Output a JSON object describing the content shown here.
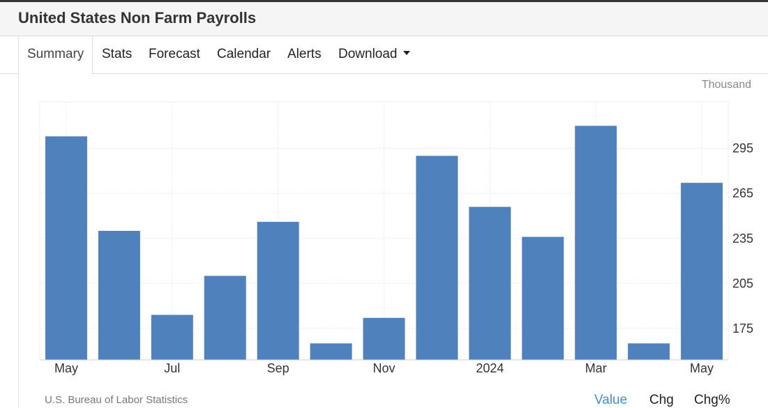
{
  "header": {
    "title": "United States Non Farm Payrolls"
  },
  "tabs": [
    {
      "label": "Summary",
      "active": true
    },
    {
      "label": "Stats"
    },
    {
      "label": "Forecast"
    },
    {
      "label": "Calendar"
    },
    {
      "label": "Alerts"
    },
    {
      "label": "Download",
      "has_dropdown": true
    }
  ],
  "chart_unit": "Thousand",
  "source": "U.S. Bureau of Labor Statistics",
  "view_options": [
    {
      "label": "Value",
      "active": true
    },
    {
      "label": "Chg"
    },
    {
      "label": "Chg%"
    }
  ],
  "colors": {
    "bar": "#4f81bd",
    "active_link": "#3e8ed6"
  },
  "chart_data": {
    "type": "bar",
    "categories": [
      "May 2023",
      "Jun 2023",
      "Jul 2023",
      "Aug 2023",
      "Sep 2023",
      "Oct 2023",
      "Nov 2023",
      "Dec 2023",
      "Jan 2024",
      "Feb 2024",
      "Mar 2024",
      "Apr 2024",
      "May 2024"
    ],
    "x_tick_labels": [
      "May",
      "",
      "Jul",
      "",
      "Sep",
      "",
      "Nov",
      "",
      "2024",
      "",
      "Mar",
      "",
      "May"
    ],
    "values": [
      303,
      240,
      184,
      210,
      246,
      165,
      182,
      290,
      256,
      236,
      310,
      165,
      272
    ],
    "y_ticks": [
      175,
      205,
      235,
      265,
      295
    ],
    "ylim": [
      154,
      326
    ],
    "ylabel": "Thousand",
    "grid": true,
    "legend": "none"
  }
}
